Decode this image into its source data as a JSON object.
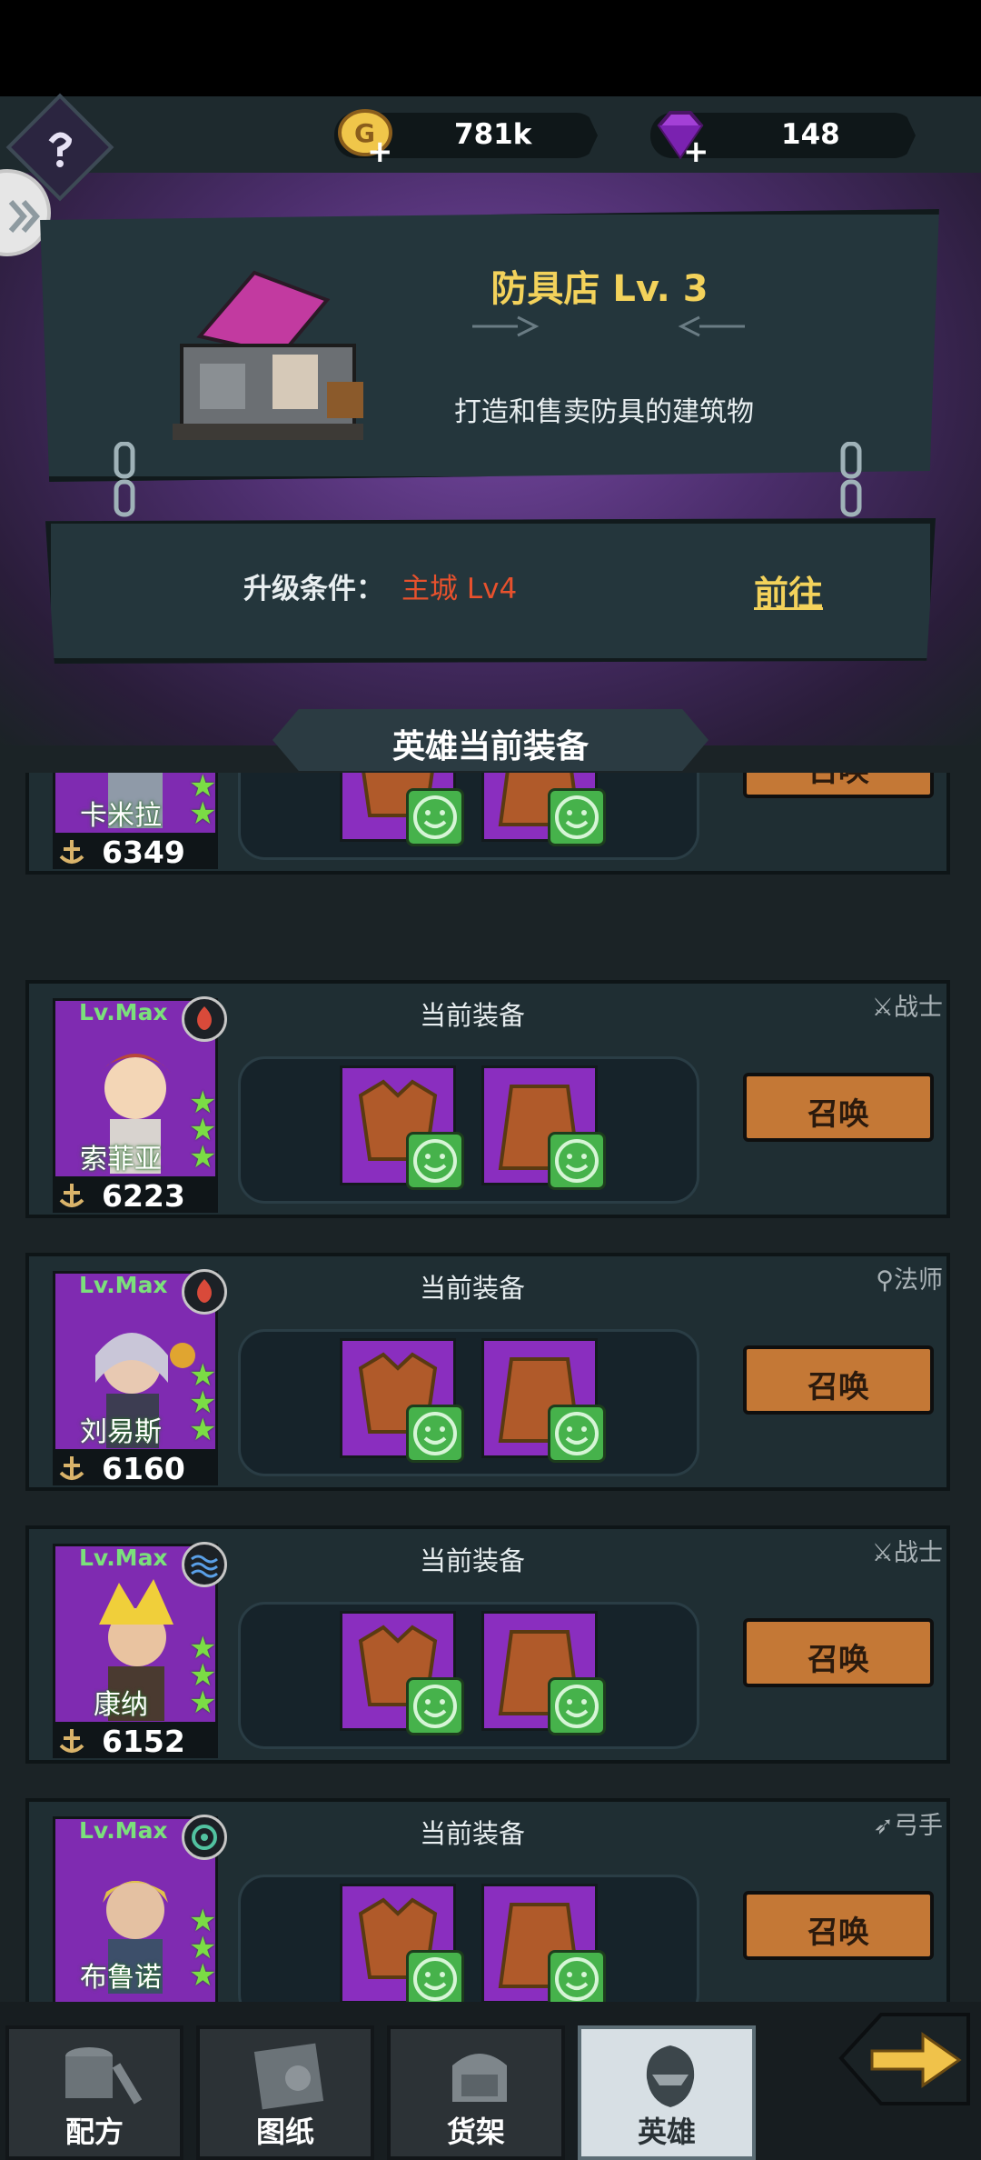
{
  "resources": {
    "gold": {
      "value": "781k",
      "icon": "gold-coin-icon"
    },
    "gems": {
      "value": "148",
      "icon": "purple-gem-icon"
    }
  },
  "shop": {
    "title": "防具店 Lv. 3",
    "description": "打造和售卖防具的建筑物"
  },
  "upgrade": {
    "label": "升级条件：",
    "value": "主城 Lv4",
    "goto_label": "前往"
  },
  "section_title": "英雄当前装备",
  "heroes": [
    {
      "level": "",
      "name": "卡米拉",
      "power": "6349",
      "class_label": "",
      "equip_label": "",
      "summon_label": "召唤"
    },
    {
      "level": "Lv.Max",
      "name": "索菲亚",
      "power": "6223",
      "class_label": "战士",
      "equip_label": "当前装备",
      "summon_label": "召唤"
    },
    {
      "level": "Lv.Max",
      "name": "刘易斯",
      "power": "6160",
      "class_label": "法师",
      "equip_label": "当前装备",
      "summon_label": "召唤"
    },
    {
      "level": "Lv.Max",
      "name": "康纳",
      "power": "6152",
      "class_label": "战士",
      "equip_label": "当前装备",
      "summon_label": "召唤"
    },
    {
      "level": "Lv.Max",
      "name": "布鲁诺",
      "power": "",
      "class_label": "弓手",
      "equip_label": "当前装备",
      "summon_label": "召唤"
    }
  ],
  "nav": {
    "tabs": [
      {
        "label": "配方",
        "icon": "recipe-icon",
        "active": false
      },
      {
        "label": "图纸",
        "icon": "blueprint-icon",
        "active": false
      },
      {
        "label": "货架",
        "icon": "shelf-icon",
        "active": false
      },
      {
        "label": "英雄",
        "icon": "hero-icon",
        "active": true
      }
    ]
  },
  "colors": {
    "accent_yellow": "#f3d25b",
    "condition_red": "#e7512d",
    "summon_orange": "#c47836",
    "portrait_purple": "#7f2bb1"
  }
}
